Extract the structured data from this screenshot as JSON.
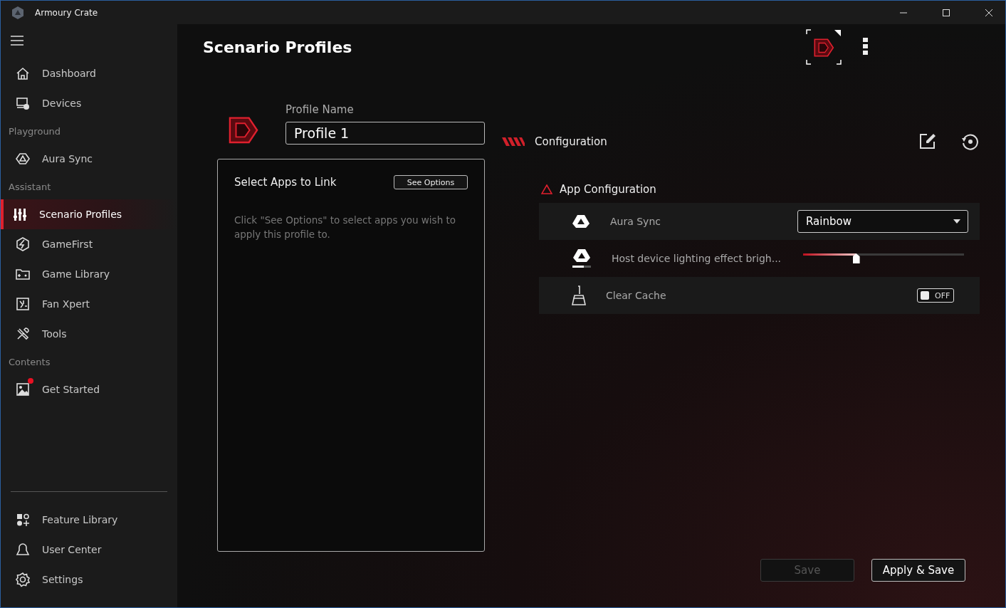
{
  "window": {
    "title": "Armoury Crate"
  },
  "sidebar": {
    "items": [
      {
        "kind": "item",
        "label": "Dashboard",
        "selected": false
      },
      {
        "kind": "item",
        "label": "Devices",
        "selected": false
      },
      {
        "kind": "section",
        "label": "Playground"
      },
      {
        "kind": "item",
        "label": "Aura Sync",
        "selected": false
      },
      {
        "kind": "section",
        "label": "Assistant"
      },
      {
        "kind": "item",
        "label": "Scenario Profiles",
        "selected": true
      },
      {
        "kind": "item",
        "label": "GameFirst",
        "selected": false
      },
      {
        "kind": "item",
        "label": "Game Library",
        "selected": false
      },
      {
        "kind": "item",
        "label": "Fan Xpert",
        "selected": false
      },
      {
        "kind": "item",
        "label": "Tools",
        "selected": false
      },
      {
        "kind": "section",
        "label": "Contents"
      },
      {
        "kind": "item",
        "label": "Get Started",
        "selected": false,
        "notification": true
      }
    ],
    "bottom_items": [
      {
        "label": "Feature Library",
        "selected": false
      },
      {
        "label": "User Center",
        "selected": false
      },
      {
        "label": "Settings",
        "selected": false
      }
    ]
  },
  "page": {
    "title": "Scenario Profiles"
  },
  "profile": {
    "label": "Profile Name",
    "value": "Profile 1"
  },
  "apps_panel": {
    "title": "Select Apps to Link",
    "button": "See Options",
    "hint": "Click \"See Options\" to select apps you wish to apply this profile to."
  },
  "configuration": {
    "title": "Configuration",
    "section": "App Configuration",
    "rows": [
      {
        "kind": "dropdown",
        "label": "Aura Sync",
        "value": "Rainbow"
      },
      {
        "kind": "slider",
        "label": "Host device lighting effect brigh...",
        "level": 0.33
      },
      {
        "kind": "toggle",
        "label": "Clear Cache",
        "on": false,
        "state_text": "OFF"
      }
    ]
  },
  "buttons": [
    {
      "label": "Save",
      "disabled": true
    },
    {
      "label": "Apply & Save",
      "disabled": false
    }
  ]
}
